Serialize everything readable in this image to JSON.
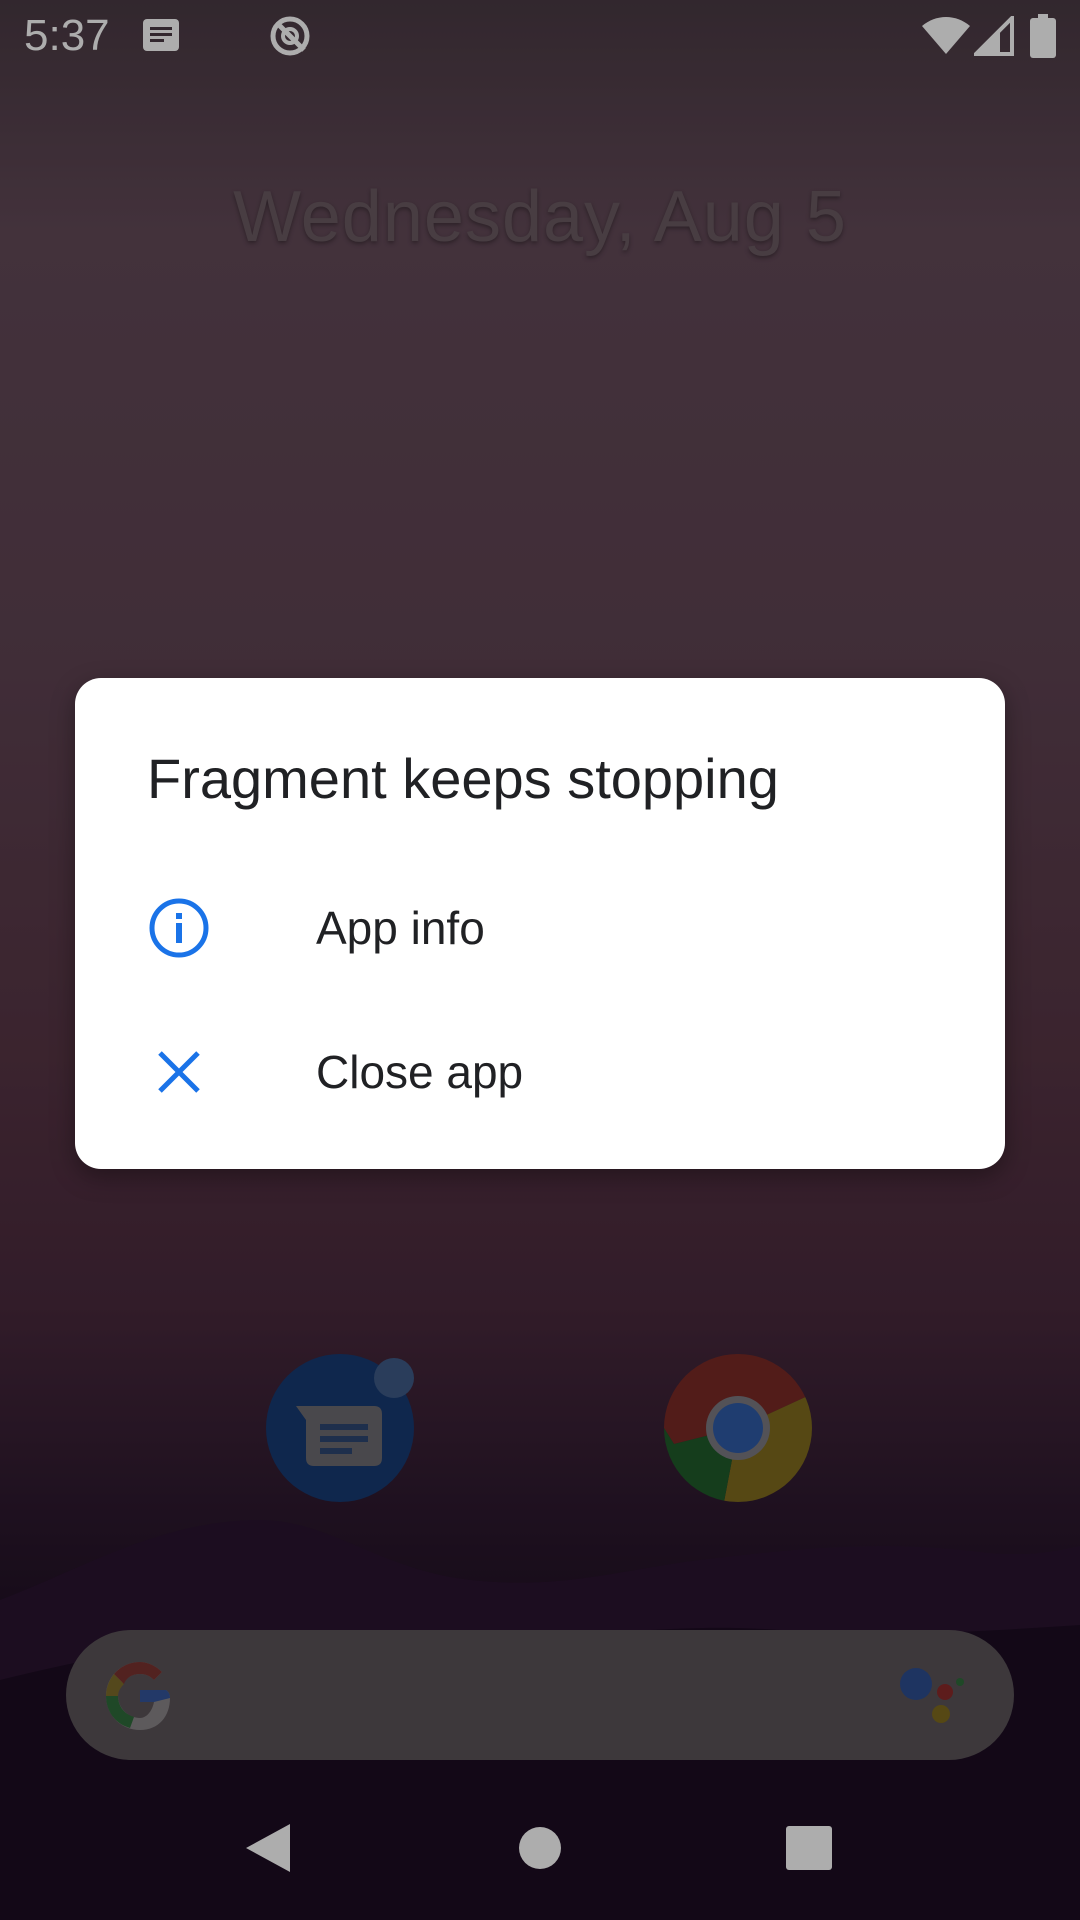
{
  "status_bar": {
    "time": "5:37",
    "icons": [
      "message-notification-icon",
      "data-saver-icon",
      "wifi-icon",
      "cell-signal-icon",
      "battery-icon"
    ]
  },
  "home": {
    "date": "Wednesday, Aug 5",
    "dock": [
      {
        "name": "messages-app-icon"
      },
      {
        "name": "chrome-app-icon"
      }
    ],
    "search_bar": {
      "icons": [
        "google-logo-icon",
        "google-assistant-icon"
      ]
    }
  },
  "dialog": {
    "title": "Fragment keeps stopping",
    "options": [
      {
        "label": "App info",
        "icon": "info-icon"
      },
      {
        "label": "Close app",
        "icon": "close-icon"
      }
    ],
    "accent_color": "#1a73e8"
  },
  "nav_bar": {
    "buttons": [
      "back-icon",
      "home-icon",
      "recents-icon"
    ]
  }
}
